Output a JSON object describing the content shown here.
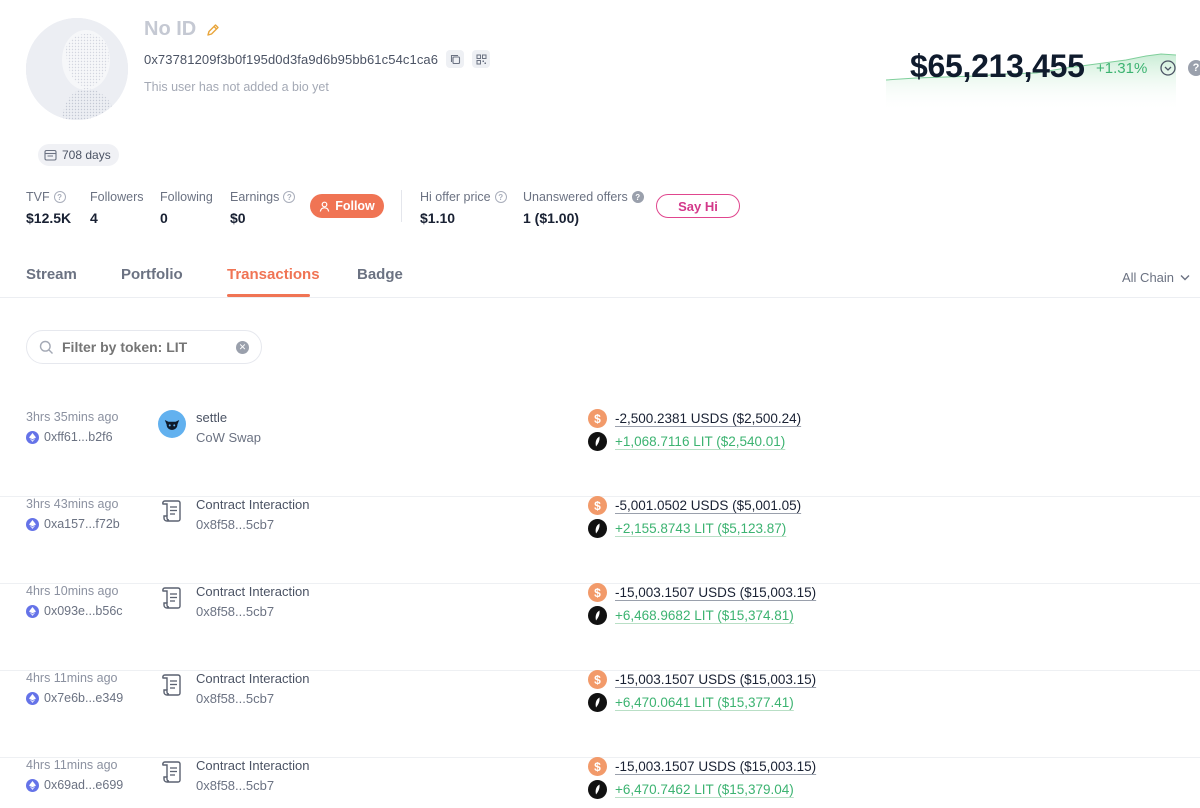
{
  "profile": {
    "name": "No ID",
    "address": "0x73781209f3b0f195d0d3fa9d6b95bb61c54c1ca6",
    "bio": "This user has not added a bio yet",
    "days": "708 days"
  },
  "net_worth": {
    "value": "$65,213,455",
    "change": "+1.31%"
  },
  "stats": {
    "tvf_label": "TVF",
    "tvf_value": "$12.5K",
    "followers_label": "Followers",
    "followers_value": "4",
    "following_label": "Following",
    "following_value": "0",
    "earnings_label": "Earnings",
    "earnings_value": "$0",
    "follow_button": "Follow",
    "hi_offer_label": "Hi offer price",
    "hi_offer_value": "$1.10",
    "unanswered_label": "Unanswered offers",
    "unanswered_value": "1 ($1.00)",
    "sayhi_button": "Say Hi"
  },
  "tabs": {
    "stream": "Stream",
    "portfolio": "Portfolio",
    "transactions": "Transactions",
    "badge": "Badge",
    "chain": "All Chain"
  },
  "filter": {
    "placeholder": "Filter by token: LIT",
    "value": "Filter by token: LIT"
  },
  "transactions": [
    {
      "time": "3hrs 35mins ago",
      "hash": "0xff61...b2f6",
      "type": "settle",
      "sub": "CoW Swap",
      "out": "-2,500.2381 USDS ($2,500.24)",
      "in": "+1,068.7116 LIT ($2,540.01)"
    },
    {
      "time": "3hrs 43mins ago",
      "hash": "0xa157...f72b",
      "type": "Contract Interaction",
      "sub": "0x8f58...5cb7",
      "out": "-5,001.0502 USDS ($5,001.05)",
      "in": "+2,155.8743 LIT ($5,123.87)"
    },
    {
      "time": "4hrs 10mins ago",
      "hash": "0x093e...b56c",
      "type": "Contract Interaction",
      "sub": "0x8f58...5cb7",
      "out": "-15,003.1507 USDS ($15,003.15)",
      "in": "+6,468.9682 LIT ($15,374.81)"
    },
    {
      "time": "4hrs 11mins ago",
      "hash": "0x7e6b...e349",
      "type": "Contract Interaction",
      "sub": "0x8f58...5cb7",
      "out": "-15,003.1507 USDS ($15,003.15)",
      "in": "+6,470.0641 LIT ($15,377.41)"
    },
    {
      "time": "4hrs 11mins ago",
      "hash": "0x69ad...e699",
      "type": "Contract Interaction",
      "sub": "0x8f58...5cb7",
      "out": "-15,003.1507 USDS ($15,003.15)",
      "in": "+6,470.7462 LIT ($15,379.04)"
    }
  ],
  "icons": {
    "avatar": "avatar-image",
    "edit": "pencil-icon",
    "copy": "copy-icon",
    "qr": "qr-code-icon",
    "calendar": "calendar-icon",
    "help": "help-icon",
    "follow": "user-icon",
    "search": "search-icon",
    "clear": "clear-icon",
    "chain": "ethereum-icon",
    "cow": "cow-swap-icon",
    "contract": "contract-scroll-icon",
    "usds": "usds-token-icon",
    "lit": "lit-token-icon"
  },
  "colors": {
    "accent": "#f07454",
    "positive": "#3cb371",
    "sayhi": "#e0468e",
    "eth": "#6573e8"
  }
}
